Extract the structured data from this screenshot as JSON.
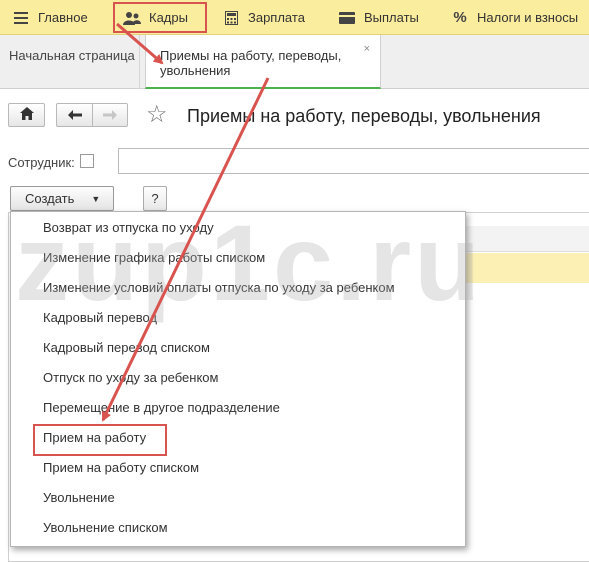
{
  "top_menu": {
    "items": [
      {
        "label": "Главное",
        "icon": "hamburger-icon"
      },
      {
        "label": "Кадры",
        "icon": "people-icon"
      },
      {
        "label": "Зарплата",
        "icon": "calculator-icon"
      },
      {
        "label": "Выплаты",
        "icon": "wallet-icon"
      },
      {
        "label": "Налоги и взносы",
        "icon": "percent-icon"
      }
    ]
  },
  "tabs": {
    "home": "Начальная страница",
    "active": "Приемы на работу, переводы, увольнения",
    "close_glyph": "×"
  },
  "header": {
    "title": "Приемы на работу, переводы, увольнения",
    "star": "☆"
  },
  "filter": {
    "employee_label": "Сотрудник:",
    "employee_value": ""
  },
  "commands": {
    "create_label": "Создать",
    "help_label": "?"
  },
  "dropdown": {
    "items": [
      "Возврат из отпуска по уходу",
      "Изменение графика работы списком",
      "Изменение условий оплаты отпуска по уходу за ребенком",
      "Кадровый перевод",
      "Кадровый перевод списком",
      "Отпуск по уходу за ребенком",
      "Перемещение в другое подразделение",
      "Прием на работу",
      "Прием на работу списком",
      "Увольнение",
      "Увольнение списком"
    ],
    "highlighted_item": "Прием на работу"
  },
  "watermark": "zup1c.ru",
  "colors": {
    "menu_bar": "#fbed9e",
    "annotation_red": "#d9534f",
    "active_tab_underline": "#4caf50"
  }
}
